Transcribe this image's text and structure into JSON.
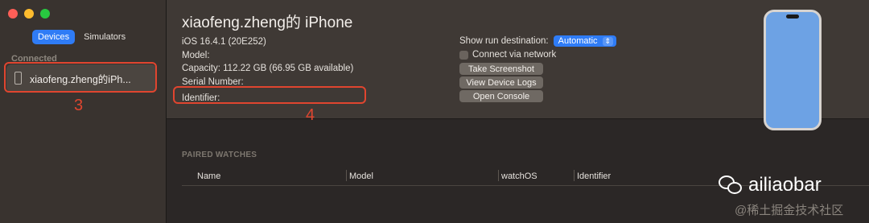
{
  "sidebar": {
    "tabs": [
      {
        "label": "Devices",
        "active": true
      },
      {
        "label": "Simulators",
        "active": false
      }
    ],
    "section_label": "Connected",
    "device": {
      "name": "xiaofeng.zheng的iPh...",
      "icon": "iphone-icon"
    }
  },
  "annotations": {
    "box3_number": "3",
    "box4_number": "4",
    "color": "#e0452f"
  },
  "header": {
    "title": "xiaofeng.zheng的 iPhone",
    "ios": "iOS 16.4.1 (20E252)",
    "model": "Model:",
    "capacity": "Capacity: 112.22 GB (66.95 GB available)",
    "serial": "Serial Number:",
    "identifier": "Identifier:"
  },
  "controls": {
    "run_destination_label": "Show run destination:",
    "run_destination_value": "Automatic",
    "connect_via_network": "Connect via network",
    "take_screenshot": "Take Screenshot",
    "view_device_logs": "View Device Logs",
    "open_console": "Open Console"
  },
  "paired_watches": {
    "label": "PAIRED WATCHES",
    "columns": [
      "Name",
      "Model",
      "watchOS",
      "Identifier"
    ]
  },
  "watermark": {
    "brand": "ailiaobar",
    "site": "@稀土掘金技术社区"
  },
  "colors": {
    "accent": "#2f7cf6",
    "sidebar_bg": "#39332f",
    "header_bg": "#3f3935"
  }
}
